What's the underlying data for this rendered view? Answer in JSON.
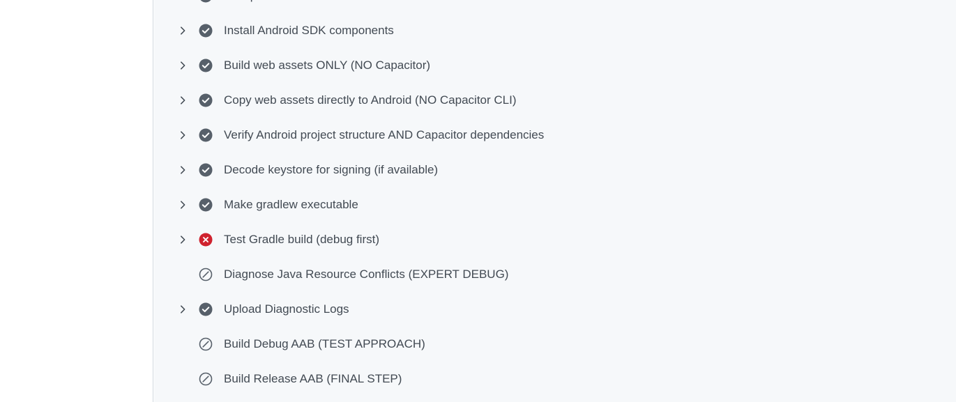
{
  "steps": [
    {
      "label": "Accept Android SDK licenses",
      "status": "success",
      "expandable": true
    },
    {
      "label": "Install Android SDK components",
      "status": "success",
      "expandable": true
    },
    {
      "label": "Build web assets ONLY (NO Capacitor)",
      "status": "success",
      "expandable": true
    },
    {
      "label": "Copy web assets directly to Android (NO Capacitor CLI)",
      "status": "success",
      "expandable": true
    },
    {
      "label": "Verify Android project structure AND Capacitor dependencies",
      "status": "success",
      "expandable": true
    },
    {
      "label": "Decode keystore for signing (if available)",
      "status": "success",
      "expandable": true
    },
    {
      "label": "Make gradlew executable",
      "status": "success",
      "expandable": true
    },
    {
      "label": "Test Gradle build (debug first)",
      "status": "failure",
      "expandable": true
    },
    {
      "label": "Diagnose Java Resource Conflicts (EXPERT DEBUG)",
      "status": "skipped",
      "expandable": false
    },
    {
      "label": "Upload Diagnostic Logs",
      "status": "success",
      "expandable": true
    },
    {
      "label": "Build Debug AAB (TEST APPROACH)",
      "status": "skipped",
      "expandable": false
    },
    {
      "label": "Build Release AAB (FINAL STEP)",
      "status": "skipped",
      "expandable": false
    }
  ],
  "icons": {
    "success": "check-circle-fill-icon",
    "failure": "x-circle-fill-icon",
    "skipped": "skip-icon",
    "expand": "chevron-right-icon"
  },
  "colors": {
    "success": "#57606a",
    "failure": "#cf222e",
    "skipped": "#57606a",
    "text": "#424a53",
    "pane_background": "#f6f8fa"
  }
}
